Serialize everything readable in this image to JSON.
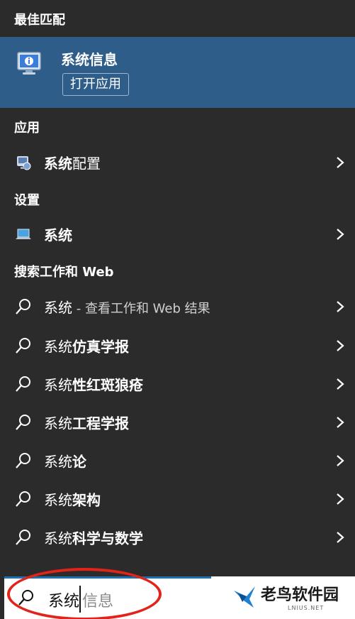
{
  "best_match": {
    "header": "最佳匹配",
    "title": "系统信息",
    "open_label": "打开应用",
    "icon": "system-info-icon"
  },
  "apps": {
    "header": "应用",
    "items": [
      {
        "prefix": "系统",
        "suffix": "配置",
        "icon": "system-config-icon"
      }
    ]
  },
  "settings": {
    "header": "设置",
    "items": [
      {
        "prefix": "系统",
        "suffix": "",
        "icon": "laptop-icon"
      }
    ]
  },
  "web": {
    "header": "搜索工作和 Web",
    "first": {
      "prefix": "系统",
      "sub": " - 查看工作和 Web 结果"
    },
    "items": [
      {
        "prefix": "系统",
        "suffix": "仿真学报"
      },
      {
        "prefix": "系统",
        "suffix": "性红斑狼疮"
      },
      {
        "prefix": "系统",
        "suffix": "工程学报"
      },
      {
        "prefix": "系统",
        "suffix": "论"
      },
      {
        "prefix": "系统",
        "suffix": "架构"
      },
      {
        "prefix": "系统",
        "suffix": "科学与数学"
      }
    ]
  },
  "search": {
    "typed": "系统",
    "hint": "信息"
  },
  "watermark": {
    "name": "老鸟软件园",
    "sub": "LNIUS.NET"
  },
  "colors": {
    "panel_bg": "#2b2b2b",
    "selected_bg": "#2f5d8a",
    "accent": "#1f6fb5",
    "highlight_ring": "#e2231a"
  }
}
